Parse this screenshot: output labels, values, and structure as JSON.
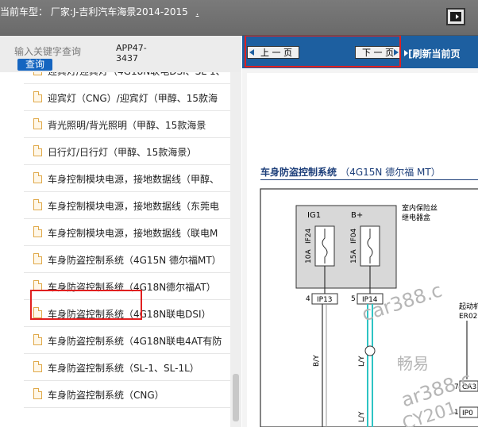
{
  "header": {
    "label": "当前车型：",
    "model": "厂家:J-吉利汽车海景2014-2015",
    "extra": "."
  },
  "search": {
    "placeholder": "输入关键字查询",
    "button_label": "查询",
    "app_code": "APP47-3437"
  },
  "tree": {
    "items": [
      {
        "label": "迎宾灯/迎宾灯（4G18N联电DSI、SL-1、"
      },
      {
        "label": "迎宾灯（CNG）/迎宾灯（甲醇、15款海"
      },
      {
        "label": "背光照明/背光照明（甲醇、15款海景"
      },
      {
        "label": "日行灯/日行灯（甲醇、15款海景）"
      },
      {
        "label": "车身控制模块电源，接地数据线（甲醇、"
      },
      {
        "label": "车身控制模块电源，接地数据线（东莞电"
      },
      {
        "label": "车身控制模块电源，接地数据线（联电M"
      },
      {
        "label": "车身防盗控制系统（4G15N 德尔福MT）"
      },
      {
        "label": "车身防盗控制系统（4G18N德尔福AT）"
      },
      {
        "label": "车身防盗控制系统（4G18N联电DSI）"
      },
      {
        "label": "车身防盗控制系统（4G18N联电4AT有防"
      },
      {
        "label": "车身防盗控制系统（SL-1、SL-1L）"
      },
      {
        "label": "车身防盗控制系统（CNG）"
      }
    ],
    "selected_index": 7
  },
  "nav": {
    "prev_label": "上 一 页",
    "next_label": "下 一 页",
    "refresh_label": "[刷新当前页"
  },
  "diagram": {
    "title": "车身防盗控制系统",
    "subtitle": "（4G15N 德尔福 MT）",
    "fuse_box_label_1": "室内保险丝",
    "fuse_box_label_2": "继电器盒",
    "col1_top": "IG1",
    "col2_top": "B+",
    "fuse1_name": "IF24",
    "fuse1_amp": "10A",
    "fuse2_name": "IF04",
    "fuse2_amp": "15A",
    "pin1": "4",
    "conn1": "IP13",
    "pin2": "5",
    "conn2": "IP14",
    "wire1": "B/Y",
    "wire2": "L/Y",
    "wire3": "L/Y",
    "right_label_1": "起动机",
    "right_label_2": "ER02",
    "pin3": "7",
    "conn3": "CA3",
    "pin4": "1",
    "conn4": "IP0"
  },
  "watermarks": {
    "wm1": "car388.c",
    "wm2": "畅易",
    "wm3": "ar388.c",
    "wm4": "CY201"
  },
  "colors": {
    "nav_blue": "#1d5fa0",
    "highlight_red": "#e02020",
    "wire_cyan": "#2ec4c4",
    "title_navy": "#1d3f7a"
  }
}
